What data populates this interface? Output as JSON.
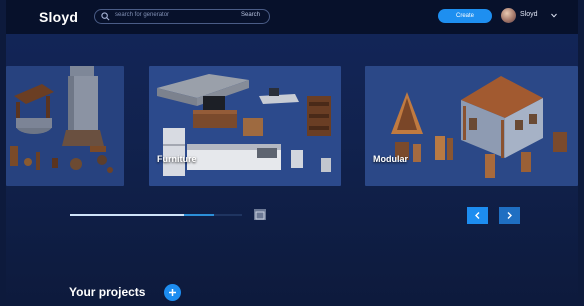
{
  "header": {
    "logo": "Sloyd",
    "search": {
      "placeholder": "search for generator",
      "submit_label": "Search"
    },
    "create_button": "Create",
    "user": {
      "name": "Sloyd"
    }
  },
  "carousel": {
    "cards": [
      {
        "label": ""
      },
      {
        "label": "Furniture"
      },
      {
        "label": "Modular"
      }
    ],
    "progress": 0.84
  },
  "projects": {
    "title": "Your projects"
  },
  "icons": [
    "search-icon",
    "chevron-down-icon",
    "fullscreen-icon",
    "chevron-left-icon",
    "chevron-right-icon",
    "plus-icon"
  ],
  "colors": {
    "accent": "#1d8df0",
    "header_bg": "#07112b",
    "page_bg": "#12244f"
  }
}
